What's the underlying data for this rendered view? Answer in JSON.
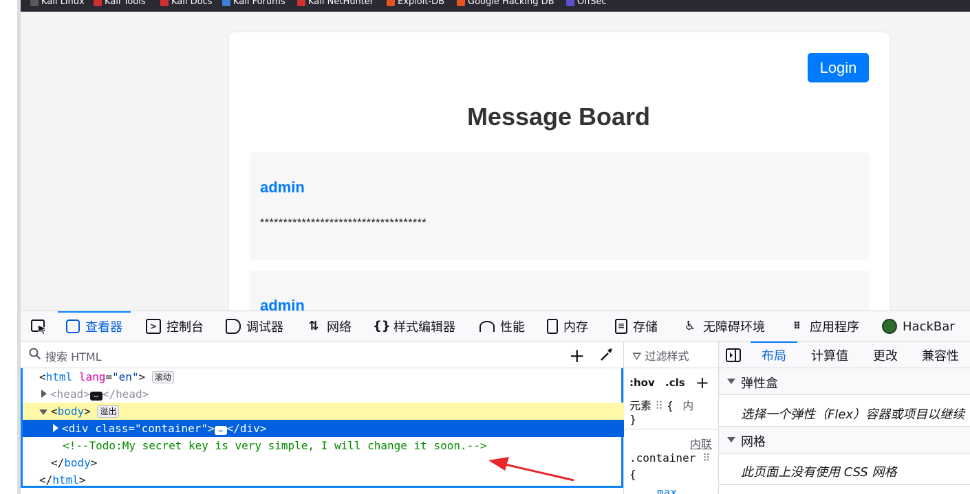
{
  "bookmarks": [
    {
      "label": "Kali Linux",
      "color": "#5a5a5a"
    },
    {
      "label": "Kali Tools",
      "color": "#d32f2f"
    },
    {
      "label": "Kali Docs",
      "color": "#d32f2f"
    },
    {
      "label": "Kali Forums",
      "color": "#3f7fd6"
    },
    {
      "label": "Kali NetHunter",
      "color": "#d32f2f"
    },
    {
      "label": "Exploit-DB",
      "color": "#e6541f"
    },
    {
      "label": "Google Hacking DB",
      "color": "#e6541f"
    },
    {
      "label": "OffSec",
      "color": "#5a4fcf"
    }
  ],
  "page": {
    "login_label": "Login",
    "title": "Message Board",
    "messages": [
      {
        "user": "admin",
        "text": "************************************"
      },
      {
        "user": "admin",
        "text": ""
      }
    ]
  },
  "devtools": {
    "tabs": [
      "查看器",
      "控制台",
      "调试器",
      "网络",
      "样式编辑器",
      "性能",
      "内存",
      "存储",
      "无障碍环境",
      "应用程序",
      "HackBar"
    ],
    "active_tab": "查看器",
    "search_placeholder": "搜索 HTML",
    "tree": {
      "html_tag": "html",
      "html_attr_name": "lang",
      "html_attr_value": "\"en\"",
      "html_badge": "滚动",
      "head_tag": "head",
      "body_tag": "body",
      "body_badge": "溢出",
      "div_tag": "div",
      "div_attr_name": "class",
      "div_attr_value": "\"container\"",
      "comment": "<!--Todo:My secret key is very simple, I will change it soon.-->"
    },
    "rules": {
      "filter_placeholder": "过滤样式",
      "hov": ":hov",
      "cls": ".cls",
      "element_label": "元素",
      "inline_abbr": "内",
      "inline_link": "内联",
      "selector": ".container",
      "open_brace": "{",
      "close_brace": "}",
      "prop_partial": "max"
    },
    "layout": {
      "tabs": [
        "布局",
        "计算值",
        "更改",
        "兼容性"
      ],
      "active_tab": "布局",
      "flex_heading": "弹性盒",
      "flex_text": "选择一个弹性（Flex）容器或项目以继续",
      "grid_heading": "网格",
      "grid_text": "此页面上没有使用 CSS 网格"
    }
  },
  "colors": {
    "accent": "#0060df",
    "login_button": "#007bff",
    "comment_green": "#058b00",
    "annotation_arrow": "#e8262b"
  }
}
